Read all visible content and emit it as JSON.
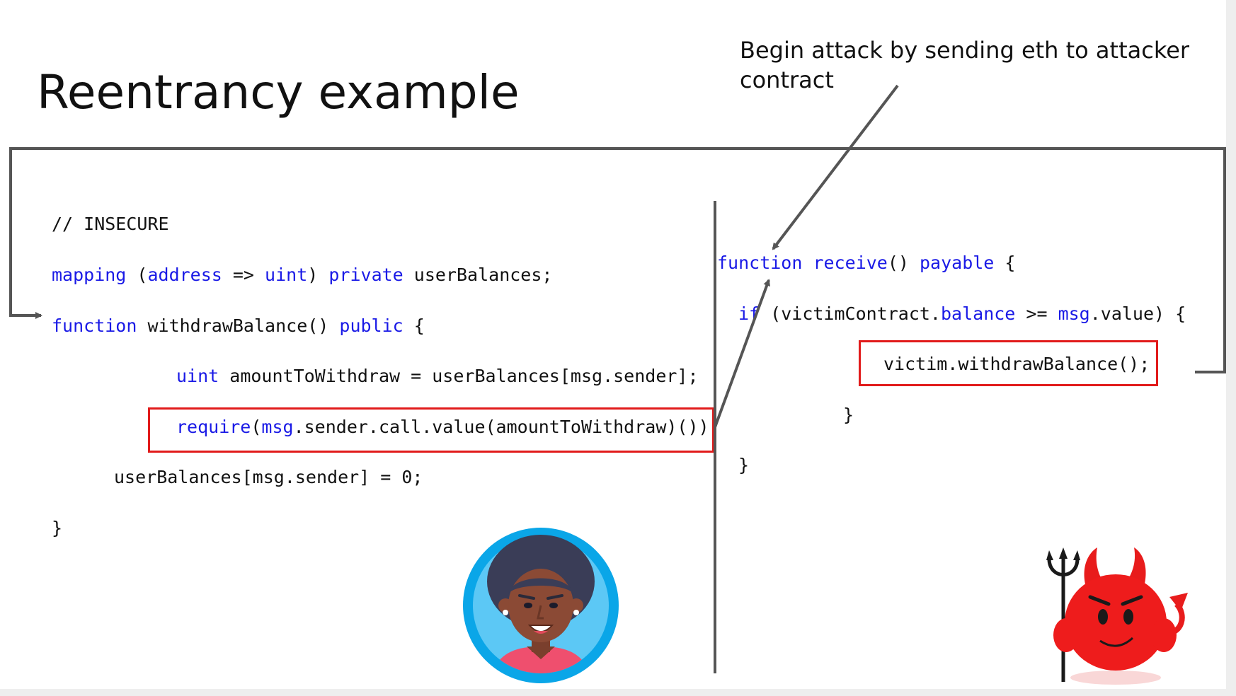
{
  "slide": {
    "title": "Reentrancy example",
    "callout_line1": "Begin attack by sending eth to attacker",
    "callout_line2": "contract"
  },
  "victim_code": {
    "comment": "// INSECURE",
    "line_mapping": {
      "kw1": "mapping",
      "p1": " (",
      "kw2": "address",
      "p2": " => ",
      "kw3": "uint",
      "p3": ") ",
      "kw4": "private",
      "p4": " userBalances;"
    },
    "line_function": {
      "kw1": "function",
      "p1": " withdrawBalance() ",
      "kw2": "public",
      "p2": " {"
    },
    "line_uint": {
      "kw1": "uint",
      "p1": " amountToWithdraw = userBalances[msg.sender];"
    },
    "line_require": {
      "kw1": "require",
      "p1": "(",
      "kw2": "msg",
      "p2": ".sender.call.value(amountToWithdraw)());"
    },
    "line_reset": "userBalances[msg.sender] = 0;",
    "line_close": "}"
  },
  "attacker_code": {
    "line_function": {
      "kw1": "function",
      "p1": " ",
      "kw2": "receive",
      "p2": "() ",
      "kw3": "payable",
      "p3": " {"
    },
    "line_if": {
      "kw1": "if",
      "p1": " (victimContract.",
      "kw2": "balance",
      "p2": " >= ",
      "kw3": "msg",
      "p3": ".value) {"
    },
    "line_call": "victim.withdrawBalance();",
    "line_close_if": "}",
    "line_close_fn": "}"
  },
  "colors": {
    "keyword": "#1a1ae6",
    "highlight_box": "#e11b1b",
    "arrow": "#555555"
  },
  "icons": {
    "victim": "woman-avatar-icon",
    "attacker": "devil-icon"
  }
}
